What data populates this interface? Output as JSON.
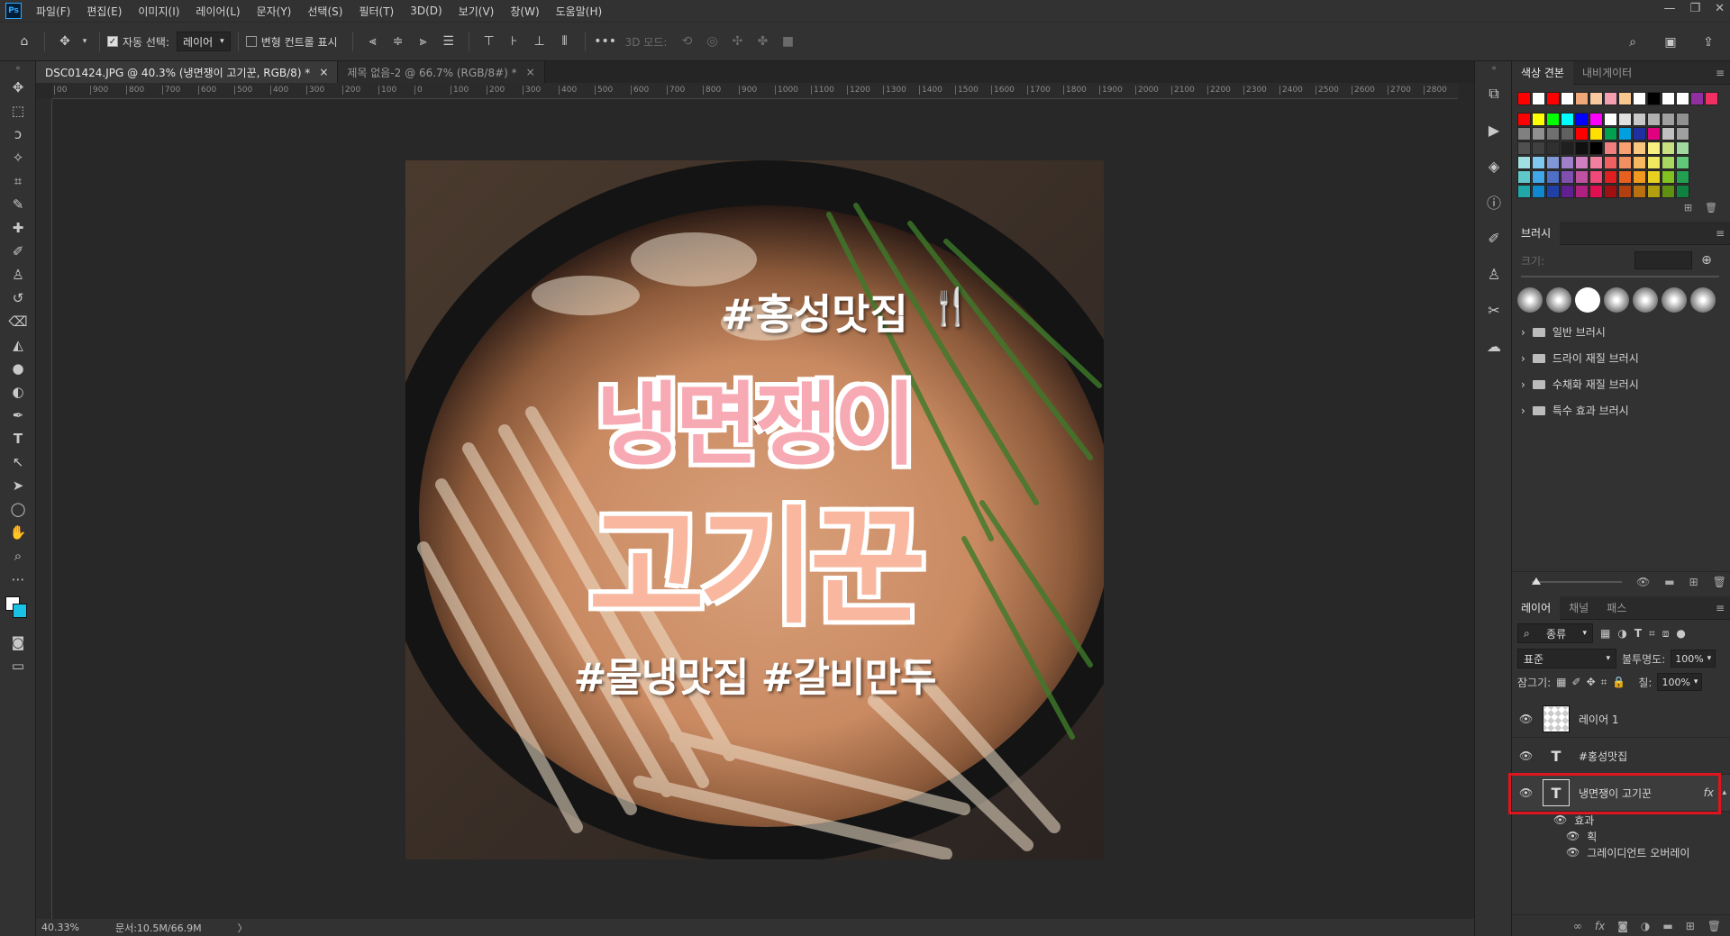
{
  "app": {
    "logo": "Ps"
  },
  "menubar": {
    "items": [
      "파일(F)",
      "편집(E)",
      "이미지(I)",
      "레이어(L)",
      "문자(Y)",
      "선택(S)",
      "필터(T)",
      "3D(D)",
      "보기(V)",
      "창(W)",
      "도움말(H)"
    ]
  },
  "window_controls": {
    "minimize": "—",
    "restore": "❐",
    "close": "✕"
  },
  "options_bar": {
    "auto_select_label": "자동 선택:",
    "auto_select_checked": true,
    "auto_select_value": "레이어",
    "transform_label": "변형 컨트롤 표시",
    "more": "•••",
    "mode_3d": "3D 모드:"
  },
  "tabs": [
    {
      "label": "DSC01424.JPG @ 40.3% (냉면쟁이 고기꾼, RGB/8) *",
      "close": "×",
      "active": true
    },
    {
      "label": "제목 없음-2 @ 66.7% (RGB/8#) *",
      "close": "×",
      "active": false
    }
  ],
  "ruler_top": [
    "00",
    "900",
    "800",
    "700",
    "600",
    "500",
    "400",
    "300",
    "200",
    "100",
    "0",
    "100",
    "200",
    "300",
    "400",
    "500",
    "600",
    "700",
    "800",
    "900",
    "1000",
    "1100",
    "1200",
    "1300",
    "1400",
    "1500",
    "1600",
    "1700",
    "1800",
    "1900",
    "2000",
    "2100",
    "2200",
    "2300",
    "2400",
    "2500",
    "2600",
    "2700",
    "2800"
  ],
  "artwork": {
    "tag_top": "#홍성맛집",
    "title_line1": "냉면쟁이",
    "title_line2": "고기꾼",
    "tag_bottom": "#물냉맛집 #갈비만두",
    "colors": {
      "pink": "#f7a9b4",
      "peach": "#f9b79f",
      "outline": "#ffffff",
      "dark": "#1a1010"
    }
  },
  "statusbar": {
    "zoom": "40.33%",
    "doc": "문서:10.5M/66.9M",
    "arrow": "〉"
  },
  "panels": {
    "swatches": {
      "tabs": [
        "색상 견본",
        "내비게이터"
      ],
      "recent": [
        "#ff0000",
        "#ffffff",
        "#ff0000",
        "#ffffff",
        "#f0a878",
        "#f8c8a0",
        "#f4a0b0",
        "#f8c890",
        "#ffffff",
        "#000000",
        "#ffffff",
        "#ffffff",
        "#9030a0",
        "#f03060"
      ],
      "grid": [
        [
          "#ff0000",
          "#ffff00",
          "#00ff00",
          "#00ffff",
          "#0000ff",
          "#ff00ff",
          "#ffffff",
          "#e0e0e0",
          "#c8c8c8",
          "#b0b0b0",
          "#a0a0a0",
          "#909090"
        ],
        [
          "#808080",
          "#909090",
          "#707070",
          "#606060",
          "#ff0000",
          "#ffe000",
          "#00a050",
          "#00a0e0",
          "#2030a0",
          "#e00080",
          "#c0c0c0",
          "#a0a0a0"
        ],
        [
          "#505050",
          "#404040",
          "#303030",
          "#202020",
          "#101010",
          "#000000",
          "#f08080",
          "#f8a070",
          "#f8c880",
          "#f8f080",
          "#c8e080",
          "#a0d8a0"
        ],
        [
          "#a0e0e0",
          "#80c8f0",
          "#8098d8",
          "#a080c8",
          "#d080c0",
          "#f080a0",
          "#f06060",
          "#f09060",
          "#f8b860",
          "#f0e860",
          "#a8d860",
          "#60c878"
        ],
        [
          "#60c8c8",
          "#40a8e8",
          "#5070c8",
          "#8050b0",
          "#c050a0",
          "#f04878",
          "#e02020",
          "#e86020",
          "#f09820",
          "#e8d020",
          "#80c020",
          "#20a050"
        ],
        [
          "#20a8a8",
          "#1088d0",
          "#2040a8",
          "#602090",
          "#b02080",
          "#e01050",
          "#a01010",
          "#b04010",
          "#b87010",
          "#b0a010",
          "#609010",
          "#108040"
        ]
      ]
    },
    "brushes": {
      "title": "브러시",
      "size_label": "크기:",
      "folders": [
        "일반 브러시",
        "드라이 재질 브러시",
        "수채화 재질 브러시",
        "특수 효과 브러시"
      ]
    },
    "layers": {
      "tabs": [
        "레이어",
        "채널",
        "패스"
      ],
      "filter_label": "종류",
      "blend_mode": "표준",
      "opacity_label": "불투명도:",
      "opacity_value": "100%",
      "lock_label": "잠그기:",
      "fill_label": "칠:",
      "fill_value": "100%",
      "items": [
        {
          "name": "레이어 1",
          "kind": "pixel",
          "selected": false
        },
        {
          "name": "#홍성맛집",
          "kind": "text",
          "selected": false
        },
        {
          "name": "냉면쟁이 고기꾼",
          "kind": "text",
          "selected": true,
          "fx": "fx"
        }
      ],
      "effects": {
        "label": "효과",
        "items": [
          "획",
          "그레이디언트 오버레이"
        ]
      },
      "highlight_color": "#e0141e"
    }
  }
}
